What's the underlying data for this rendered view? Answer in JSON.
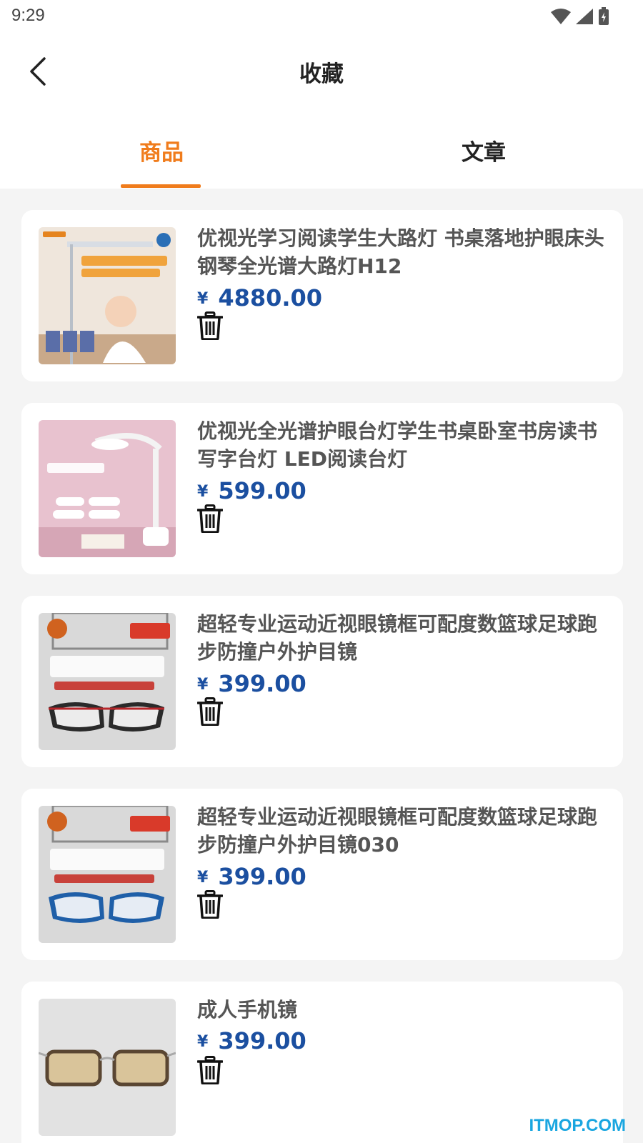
{
  "status_bar": {
    "time": "9:29"
  },
  "header": {
    "title": "收藏"
  },
  "tabs": [
    {
      "label": "商品",
      "active": true
    },
    {
      "label": "文章",
      "active": false
    }
  ],
  "currency_symbol": "¥",
  "products": [
    {
      "title": "优视光学习阅读学生大路灯 书桌落地护眼床头钢琴全光谱大路灯H12",
      "price": "4880.00",
      "image": "floor-lamp-photo"
    },
    {
      "title": "优视光全光谱护眼台灯学生书桌卧室书房读书写字台灯 LED阅读台灯",
      "price": "599.00",
      "image": "desk-lamp-photo"
    },
    {
      "title": "超轻专业运动近视眼镜框可配度数篮球足球跑步防撞户外护目镜",
      "price": "399.00",
      "image": "sports-goggles-red-photo"
    },
    {
      "title": "超轻专业运动近视眼镜框可配度数篮球足球跑步防撞户外护目镜030",
      "price": "399.00",
      "image": "sports-goggles-blue-photo"
    },
    {
      "title": "成人手机镜",
      "price": "399.00",
      "image": "tinted-glasses-photo"
    }
  ],
  "watermark": "ITMOP.COM",
  "colors": {
    "accent": "#f07c1c",
    "price": "#1b4fa0",
    "background": "#f4f4f4"
  }
}
